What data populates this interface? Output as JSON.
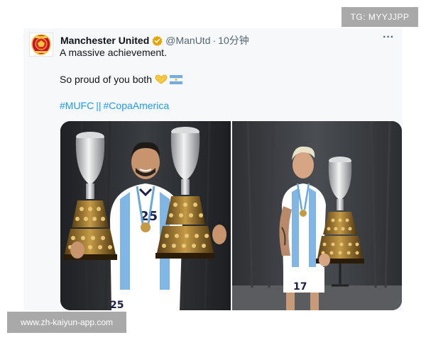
{
  "watermark_top": "TG: MYYJJPP",
  "watermark_bottom": "www.zh-kaiyun-app.com",
  "tweet": {
    "account_name": "Manchester United",
    "handle": "@ManUtd",
    "separator": "·",
    "time": "10分钟",
    "more_label": "···",
    "line1": "A massive achievement.",
    "line2": "So proud of you both",
    "hashtag1": "#MUFC",
    "hashtag_separator": "||",
    "hashtag2": "#CopaAmerica",
    "left_photo_jersey_number": "25",
    "right_photo_jersey_number": "17",
    "colors": {
      "link": "#1d9bf0",
      "verified_badge": "#e8a300",
      "card_background": "#f7f8fa"
    }
  }
}
